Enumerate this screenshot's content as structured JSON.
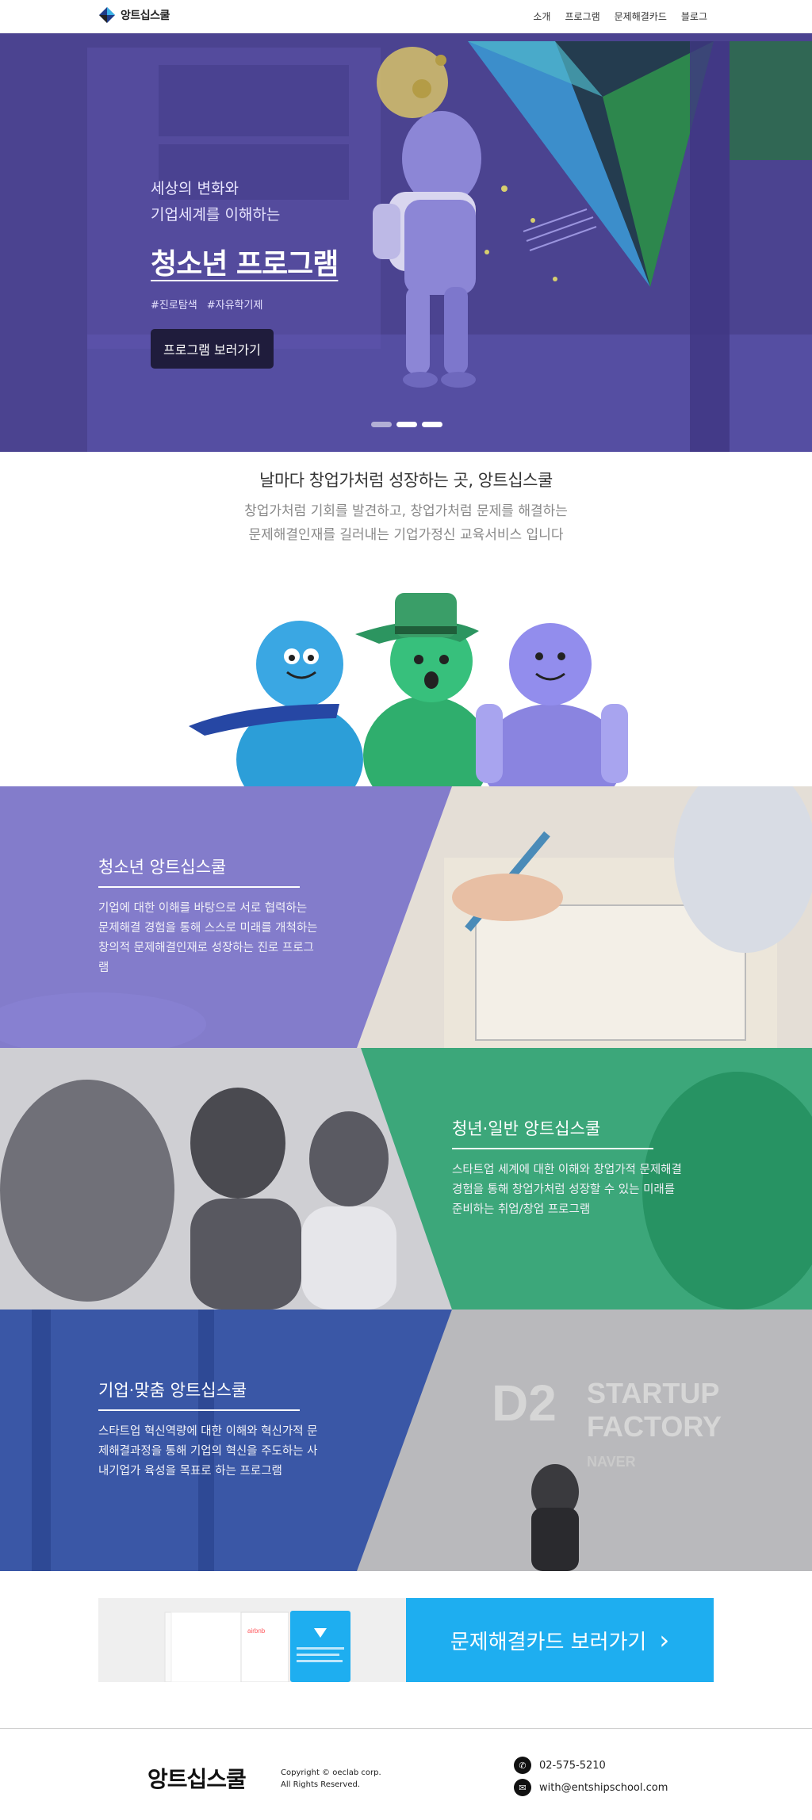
{
  "nav": {
    "logo_text": "앙트십스쿨",
    "menu": [
      "소개",
      "프로그램",
      "문제해결카드",
      "블로그"
    ]
  },
  "hero": {
    "subtitle_line1": "세상의 변화와",
    "subtitle_line2": "기업세계를 이해하는",
    "title": "청소년 프로그램",
    "tags": [
      "#진로탐색",
      "#자유학기제"
    ],
    "button": "프로그램 보러가기",
    "slides": 3,
    "active_slide": 2
  },
  "intro": {
    "heading": "날마다 창업가처럼 성장하는 곳, 앙트십스쿨",
    "line1": "창업가처럼 기회를 발견하고, 창업가처럼 문제를 해결하는",
    "line2": "문제해결인재를 길러내는 기업가정신 교육서비스 입니다"
  },
  "programs": [
    {
      "title": "청소년 앙트십스쿨",
      "desc": "기업에 대한 이해를 바탕으로 서로 협력하는 문제해결 경험을 통해 스스로 미래를 개척하는 창의적 문제해결인재로 성장하는 진로 프로그램",
      "color": "#7a74d6"
    },
    {
      "title": "청년·일반 앙트십스쿨",
      "desc": "스타트업 세계에 대한 이해와 창업가적 문제해결 경험을 통해 창업가처럼 성장할 수 있는 미래를 준비하는 취업/창업 프로그램",
      "color": "#2aa874"
    },
    {
      "title": "기업·맞춤 앙트십스쿨",
      "desc": "스타트업 혁신역량에 대한 이해와 혁신가적 문제해결과정을 통해 기업의 혁신을 주도하는 사내기업가 육성을 목표로 하는 프로그램",
      "color": "#2e4ea6"
    }
  ],
  "backdrop_text": {
    "d2": "D2",
    "startup": "STARTUP",
    "factory": "FACTORY",
    "naver": "NAVER",
    "airbnb": "airbnb"
  },
  "cards_banner": {
    "label": "문제해결카드 보러가기",
    "arrow": "›"
  },
  "footer": {
    "logo": "앙트십스쿨",
    "copyright_line1": "Copyright © oeclab corp.",
    "copyright_line2": "All Rights Reserved.",
    "phone": "02-575-5210",
    "email": "with@entshipschool.com"
  }
}
